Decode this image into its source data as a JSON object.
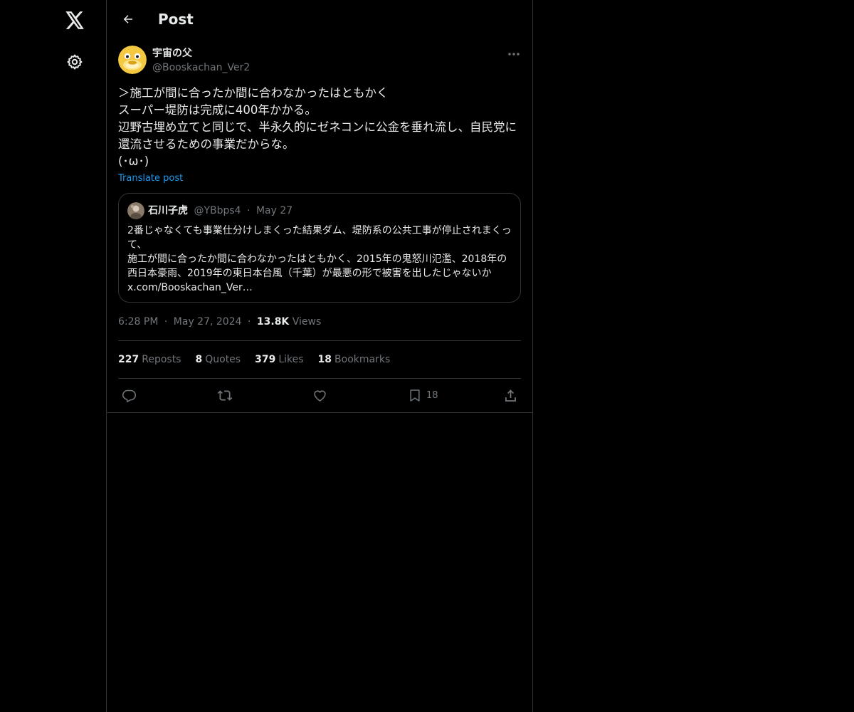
{
  "nav": {
    "logo_icon": "x-logo-icon",
    "settings_icon": "gear-icon"
  },
  "header": {
    "title": "Post",
    "back_icon": "arrow-left-icon"
  },
  "post": {
    "author": {
      "display_name": "宇宙の父",
      "handle": "@Booskachan_Ver2"
    },
    "text": "＞施工が間に合ったか間に合わなかったはともかく\nスーパー堤防は完成に400年かかる。\n辺野古埋め立てと同じで、半永久的にゼネコンに公金を垂れ流し、自民党に還流させるための事業だからな。\n(･ω･)",
    "translate_label": "Translate post",
    "quote": {
      "display_name": "石川子虎",
      "handle": "@YBbps4",
      "separator": "·",
      "date": "May 27",
      "text": "2番じゃなくても事業仕分けしまくった結果ダム、堤防系の公共工事が停止されまくって、\n施工が間に合ったか間に合わなかったはともかく、2015年の鬼怒川氾濫、2018年の西日本豪雨、2019年の東日本台風（千葉）が最悪の形で被害を出したじゃないか x.com/Booskachan_Ver…"
    },
    "meta": {
      "time": "6:28 PM",
      "sep1": "·",
      "date": "May 27, 2024",
      "sep2": "·",
      "views_count": "13.8K",
      "views_label": "Views"
    },
    "stats": [
      {
        "count": "227",
        "label": "Reposts"
      },
      {
        "count": "8",
        "label": "Quotes"
      },
      {
        "count": "379",
        "label": "Likes"
      },
      {
        "count": "18",
        "label": "Bookmarks"
      }
    ],
    "actions": {
      "reply_icon": "reply-icon",
      "repost_icon": "repost-icon",
      "like_icon": "heart-icon",
      "bookmark_icon": "bookmark-icon",
      "bookmark_count": "18",
      "share_icon": "share-icon"
    }
  },
  "colors": {
    "background": "#000000",
    "text": "#e7e9ea",
    "muted": "#71767b",
    "border": "#2f3336",
    "link": "#1d9bf0",
    "avatar_yellow": "#f5c842"
  }
}
